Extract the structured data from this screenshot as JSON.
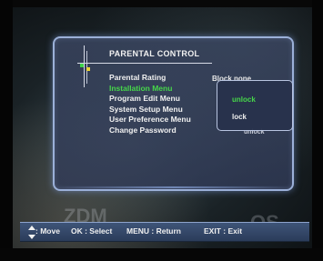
{
  "panel": {
    "title": "PARENTAL CONTROL"
  },
  "menu": {
    "items": [
      {
        "label": "Parental Rating"
      },
      {
        "label": "Installation Menu"
      },
      {
        "label": "Program Edit Menu"
      },
      {
        "label": "System Setup Menu"
      },
      {
        "label": "User Preference Menu"
      },
      {
        "label": "Change Password"
      }
    ],
    "selected_index": 1
  },
  "values": {
    "parental_rating": "Block none",
    "user_preference_partial": "unlock"
  },
  "dropdown": {
    "options": [
      "unlock",
      "lock"
    ],
    "highlighted": "unlock"
  },
  "help_bar": {
    "move": ": Move",
    "select": "OK : Select",
    "return": "MENU : Return",
    "exit": "EXIT : Exit"
  },
  "colors": {
    "selected_text": "#46d64a",
    "panel_border": "#9bb0d8",
    "help_bar_bg": "#34496b"
  },
  "background_text": {
    "left": "ZDM",
    "right": "OS"
  }
}
